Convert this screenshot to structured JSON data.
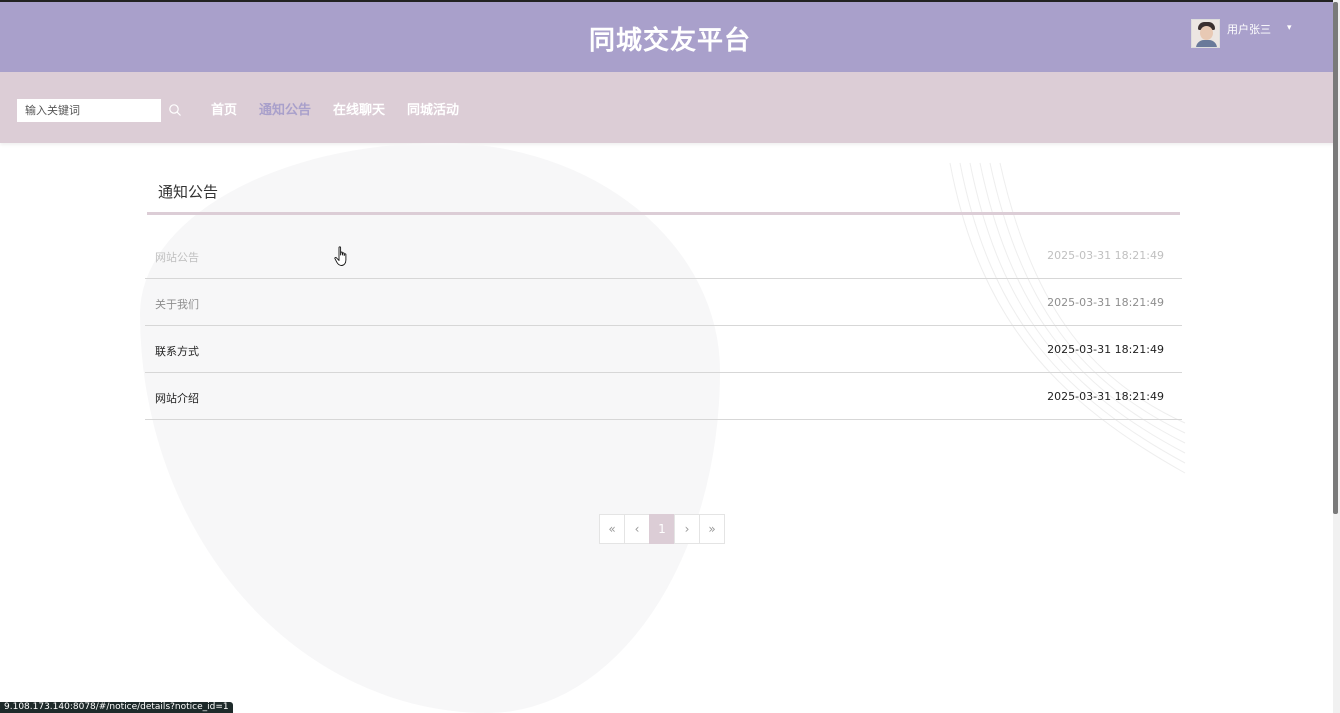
{
  "header": {
    "site_title": "同城交友平台",
    "user": {
      "name": "用户张三",
      "caret_icon": "caret-down-icon"
    }
  },
  "nav": {
    "search_placeholder": "输入关键词",
    "search_icon": "search-icon",
    "items": [
      {
        "label": "首页",
        "active": false
      },
      {
        "label": "通知公告",
        "active": true
      },
      {
        "label": "在线聊天",
        "active": false
      },
      {
        "label": "同城活动",
        "active": false
      }
    ]
  },
  "main": {
    "section_title": "通知公告",
    "notices": [
      {
        "title": "网站公告",
        "date": "2025-03-31 18:21:49"
      },
      {
        "title": "关于我们",
        "date": "2025-03-31 18:21:49"
      },
      {
        "title": "联系方式",
        "date": "2025-03-31 18:21:49"
      },
      {
        "title": "网站介绍",
        "date": "2025-03-31 18:21:49"
      }
    ]
  },
  "pagination": {
    "first": "«",
    "prev": "‹",
    "current": "1",
    "next": "›",
    "last": "»"
  },
  "status_bar": {
    "url": "9.108.173.140:8078/#/notice/details?notice_id=1"
  },
  "colors": {
    "header_bg": "#a9a0cb",
    "nav_bg": "#dccdd6",
    "active_nav": "#a9a0cb"
  }
}
